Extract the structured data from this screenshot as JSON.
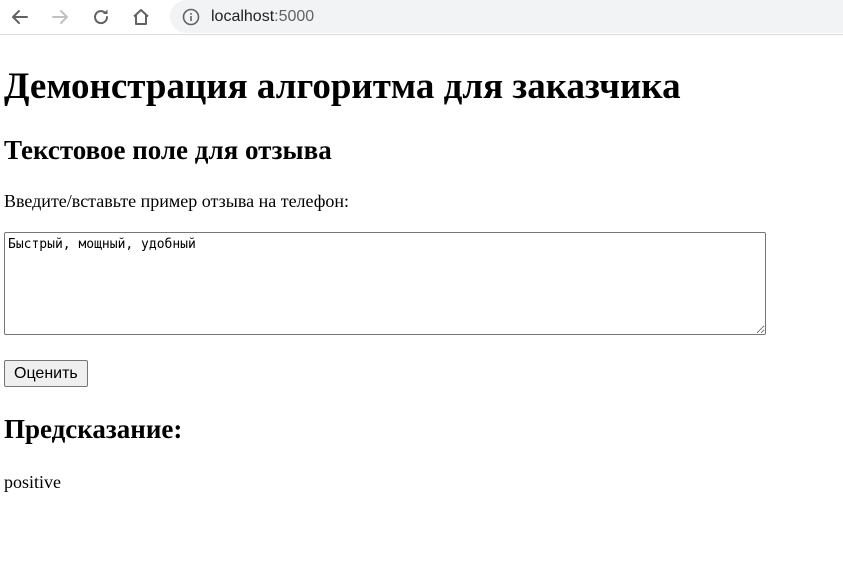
{
  "browser": {
    "url_host": "localhost",
    "url_port": ":5000",
    "icons": [
      "back-arrow-icon",
      "forward-arrow-icon",
      "reload-icon",
      "home-icon",
      "info-icon"
    ]
  },
  "page": {
    "title": "Демонстрация алгоритма для заказчика",
    "review_section_heading": "Текстовое поле для отзыва",
    "review_prompt": "Введите/вставьте пример отзыва на телефон:",
    "review_text": "Быстрый, мощный, удобный",
    "submit_label": "Оценить",
    "prediction_heading": "Предсказание:",
    "prediction_value": "positive"
  }
}
